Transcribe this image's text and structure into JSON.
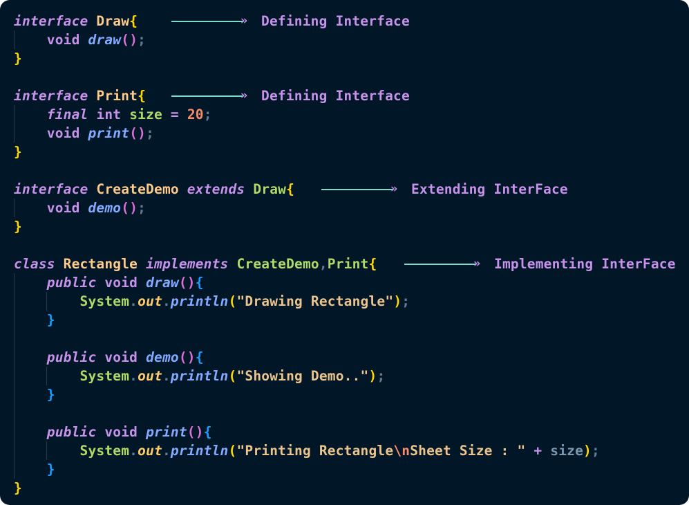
{
  "code": {
    "l1": {
      "kw": "interface",
      "name": "Draw",
      "brace": "{"
    },
    "l2": {
      "type": "void",
      "fn": "draw",
      "open": "(",
      "close": ")",
      "semi": ";"
    },
    "l3": {
      "brace": "}"
    },
    "l5": {
      "kw": "interface",
      "name": "Print",
      "brace": "{"
    },
    "l6": {
      "kw": "final",
      "type": "int",
      "var": "size",
      "op": "=",
      "num": "20",
      "semi": ";"
    },
    "l7": {
      "type": "void",
      "fn": "print",
      "open": "(",
      "close": ")",
      "semi": ";"
    },
    "l8": {
      "brace": "}"
    },
    "l10": {
      "kw": "interface",
      "name": "CreateDemo",
      "ext": "extends",
      "parent": "Draw",
      "brace": "{"
    },
    "l11": {
      "type": "void",
      "fn": "demo",
      "open": "(",
      "close": ")",
      "semi": ";"
    },
    "l12": {
      "brace": "}"
    },
    "l14": {
      "kw": "class",
      "name": "Rectangle",
      "impl": "implements",
      "p1": "CreateDemo",
      "comma": ",",
      "p2": "Print",
      "brace": "{"
    },
    "l15": {
      "mod": "public",
      "type": "void",
      "fn": "draw",
      "open": "(",
      "close": ")",
      "brace": "{"
    },
    "l16": {
      "sys": "System",
      "dot": ".",
      "out": "out",
      "fn": "println",
      "open": "(",
      "str": "\"Drawing Rectangle\"",
      "close": ")",
      "semi": ";"
    },
    "l17": {
      "brace": "}"
    },
    "l19": {
      "mod": "public",
      "type": "void",
      "fn": "demo",
      "open": "(",
      "close": ")",
      "brace": "{"
    },
    "l20": {
      "sys": "System",
      "dot": ".",
      "out": "out",
      "fn": "println",
      "open": "(",
      "str": "\"Showing Demo..\"",
      "close": ")",
      "semi": ";"
    },
    "l21": {
      "brace": "}"
    },
    "l23": {
      "mod": "public",
      "type": "void",
      "fn": "print",
      "open": "(",
      "close": ")",
      "brace": "{"
    },
    "l24": {
      "sys": "System",
      "dot": ".",
      "out": "out",
      "fn": "println",
      "open": "(",
      "str1": "\"Printing Rectangle",
      "esc": "\\n",
      "str2": "Sheet Size : \"",
      "op": "+",
      "var": "size",
      "close": ")",
      "semi": ";"
    },
    "l25": {
      "brace": "}"
    },
    "l26": {
      "brace": "}"
    }
  },
  "annotations": {
    "a1": "Defining Interface",
    "a2": "Defining Interface",
    "a3": "Extending InterFace",
    "a4": "Implementing InterFace",
    "arrow_head": "»"
  }
}
